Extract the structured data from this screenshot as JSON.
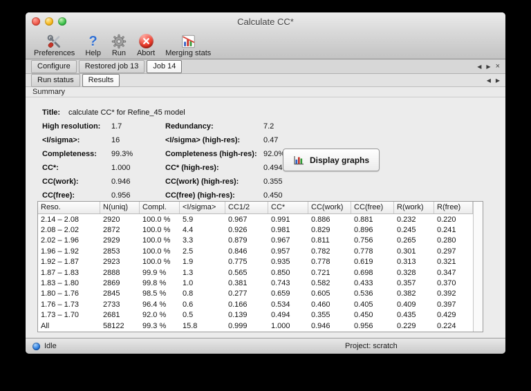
{
  "window": {
    "title": "Calculate CC*"
  },
  "toolbar": {
    "items": [
      {
        "label": "Preferences",
        "icon": "preferences-icon"
      },
      {
        "label": "Help",
        "icon": "help-icon",
        "glyph": "?"
      },
      {
        "label": "Run",
        "icon": "run-icon"
      },
      {
        "label": "Abort",
        "icon": "abort-icon"
      },
      {
        "label": "Merging stats",
        "icon": "merging-stats-icon"
      }
    ]
  },
  "tabs": {
    "main": [
      {
        "label": "Configure",
        "active": false
      },
      {
        "label": "Restored job 13",
        "active": false
      },
      {
        "label": "Job 14",
        "active": true
      }
    ],
    "sub": [
      {
        "label": "Run status",
        "active": false
      },
      {
        "label": "Results",
        "active": true
      }
    ],
    "nav": {
      "left": "◀",
      "right": "▶",
      "close": "×"
    }
  },
  "section": {
    "label": "Summary"
  },
  "summary": {
    "title_label": "Title:",
    "title_value": "calculate CC* for Refine_45 model",
    "rows": [
      {
        "label1": "High resolution:",
        "value1": "1.7",
        "label2": "Redundancy:",
        "value2": "7.2"
      },
      {
        "label1": "<I/sigma>:",
        "value1": "16",
        "label2": "<I/sigma> (high-res):",
        "value2": "0.47"
      },
      {
        "label1": "Completeness:",
        "value1": "99.3%",
        "label2": "Completeness (high-res):",
        "value2": "92.0%"
      },
      {
        "label1": "CC*:",
        "value1": "1.000",
        "label2": "CC* (high-res):",
        "value2": "0.494"
      },
      {
        "label1": "CC(work):",
        "value1": "0.946",
        "label2": "CC(work) (high-res):",
        "value2": "0.355"
      },
      {
        "label1": "CC(free):",
        "value1": "0.956",
        "label2": "CC(free) (high-res):",
        "value2": "0.450"
      }
    ],
    "display_graphs_button": "Display graphs"
  },
  "table": {
    "headers": [
      "Reso.",
      "N(uniq)",
      "Compl.",
      "<I/sigma>",
      "CC1/2",
      "CC*",
      "CC(work)",
      "CC(free)",
      "R(work)",
      "R(free)"
    ],
    "rows": [
      [
        "2.14 – 2.08",
        "2920",
        "100.0 %",
        "5.9",
        "0.967",
        "0.991",
        "0.886",
        "0.881",
        "0.232",
        "0.220"
      ],
      [
        "2.08 – 2.02",
        "2872",
        "100.0 %",
        "4.4",
        "0.926",
        "0.981",
        "0.829",
        "0.896",
        "0.245",
        "0.241"
      ],
      [
        "2.02 – 1.96",
        "2929",
        "100.0 %",
        "3.3",
        "0.879",
        "0.967",
        "0.811",
        "0.756",
        "0.265",
        "0.280"
      ],
      [
        "1.96 – 1.92",
        "2853",
        "100.0 %",
        "2.5",
        "0.846",
        "0.957",
        "0.782",
        "0.778",
        "0.301",
        "0.297"
      ],
      [
        "1.92 – 1.87",
        "2923",
        "100.0 %",
        "1.9",
        "0.775",
        "0.935",
        "0.778",
        "0.619",
        "0.313",
        "0.321"
      ],
      [
        "1.87 – 1.83",
        "2888",
        "99.9 %",
        "1.3",
        "0.565",
        "0.850",
        "0.721",
        "0.698",
        "0.328",
        "0.347"
      ],
      [
        "1.83 – 1.80",
        "2869",
        "99.8 %",
        "1.0",
        "0.381",
        "0.743",
        "0.582",
        "0.433",
        "0.357",
        "0.370"
      ],
      [
        "1.80 – 1.76",
        "2845",
        "98.5 %",
        "0.8",
        "0.277",
        "0.659",
        "0.605",
        "0.536",
        "0.382",
        "0.392"
      ],
      [
        "1.76 – 1.73",
        "2733",
        "96.4 %",
        "0.6",
        "0.166",
        "0.534",
        "0.460",
        "0.405",
        "0.409",
        "0.397"
      ],
      [
        "1.73 – 1.70",
        "2681",
        "92.0 %",
        "0.5",
        "0.139",
        "0.494",
        "0.355",
        "0.450",
        "0.435",
        "0.429"
      ],
      [
        "All",
        "58122",
        "99.3 %",
        "15.8",
        "0.999",
        "1.000",
        "0.946",
        "0.956",
        "0.229",
        "0.224"
      ]
    ]
  },
  "status_bar": {
    "status": "Idle",
    "project": "Project: scratch"
  },
  "colors": {
    "accent_blue": "#2f6fd4",
    "abort_red": "#ee3a2a",
    "led_blue": "#2e7fe0"
  }
}
